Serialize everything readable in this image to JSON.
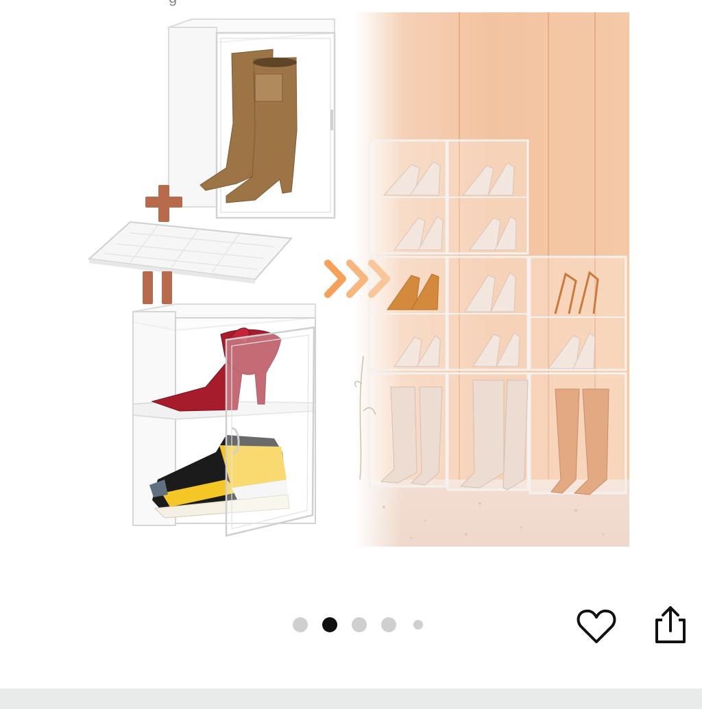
{
  "product_image": {
    "top_caption_fragment": "g",
    "accent_color": "#f6a15a",
    "plus_color": "#b86a4c",
    "equals_color": "#b86a4c",
    "wall_color": "#f6c9a7"
  },
  "carousel": {
    "total": 5,
    "active_index": 1,
    "dots": [
      "dot-1",
      "dot-2",
      "dot-3",
      "dot-4",
      "dot-5"
    ]
  },
  "actions": {
    "favorite_icon": "heart-outline-icon",
    "share_icon": "share-icon"
  }
}
